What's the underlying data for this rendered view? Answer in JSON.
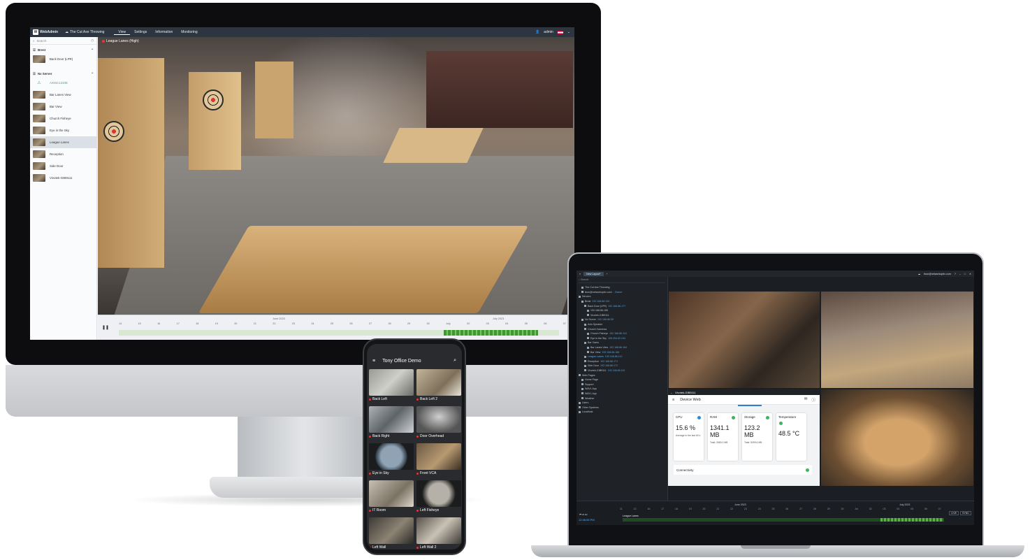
{
  "webadmin": {
    "brand": "WebAdmin",
    "site_name": "The Cut Axe Throwing",
    "nav": [
      "View",
      "Settings",
      "Information",
      "Monitoring"
    ],
    "user": "admin",
    "search_placeholder": "Search",
    "groups": [
      {
        "label": "Brest",
        "items": [
          "Back Door (LPR)"
        ]
      },
      {
        "label": "Nx Server",
        "items": [
          "AXISC1310E",
          "Bar Lanes View",
          "Bar View",
          "Church Fisheye",
          "Eye in the Sky",
          "League Lanes",
          "Reception",
          "Side Door",
          "Vivotek-GIB9111"
        ]
      }
    ],
    "active_item": "League Lanes",
    "video_label": "League Lanes (High)",
    "timeline": {
      "month_left": "June 2023",
      "month_right": "July 2023",
      "ticks": [
        "14",
        "15",
        "16",
        "17",
        "18",
        "19",
        "20",
        "21",
        "22",
        "23",
        "24",
        "25",
        "26",
        "27",
        "28",
        "29",
        "30",
        "July",
        "02",
        "03",
        "04",
        "05",
        "06",
        "07"
      ]
    }
  },
  "desktop": {
    "tab": "New Layout*",
    "account": "tbon@networkoptix.com",
    "search_placeholder": "Search",
    "tree": [
      {
        "label": "The Cut Axe Throwing",
        "ip": ""
      },
      {
        "label": "tbon@networkoptix.com",
        "ip": "- Owner"
      },
      {
        "label": "Servers",
        "ip": ""
      },
      {
        "label": "Brest",
        "ip": "192.168.86.130"
      },
      {
        "label": "Back Door (LPR)",
        "ip": "192.168.86.177"
      },
      {
        "label": "192.168.86.185",
        "ip": ""
      },
      {
        "label": "Vivotek-GIB9111",
        "ip": ""
      },
      {
        "label": "Nx Server",
        "ip": "192.168.86.59"
      },
      {
        "label": "Axis Speaker",
        "ip": ""
      },
      {
        "label": "Church Cameras",
        "ip": ""
      },
      {
        "label": "Church Fisheye",
        "ip": "192.168.86.110"
      },
      {
        "label": "Eye in the Sky",
        "ip": "169.254.62.244"
      },
      {
        "label": "Bar Cams",
        "ip": ""
      },
      {
        "label": "Bar Lanes View",
        "ip": "192.168.86.184"
      },
      {
        "label": "Bar View",
        "ip": "192.168.86.186"
      },
      {
        "label": "League Lanes",
        "ip": "192.168.86.112"
      },
      {
        "label": "Reception",
        "ip": "192.168.86.171"
      },
      {
        "label": "Side Door",
        "ip": "192.168.86.172"
      },
      {
        "label": "Vivotek-GIB9111",
        "ip": "192.168.86.119"
      },
      {
        "label": "Web Pages",
        "ip": ""
      },
      {
        "label": "Home Page",
        "ip": ""
      },
      {
        "label": "Support",
        "ip": ""
      },
      {
        "label": "WAVL App",
        "ip": ""
      },
      {
        "label": "WAYL App",
        "ip": ""
      },
      {
        "label": "Weather",
        "ip": ""
      },
      {
        "label": "Users",
        "ip": ""
      },
      {
        "label": "Other Systems",
        "ip": ""
      },
      {
        "label": "Localhost",
        "ip": ""
      }
    ],
    "device_web": {
      "camera": "Vivotek-GIB9111",
      "title": "Device Web",
      "cards": [
        {
          "label": "CPU",
          "value": "15.6 %",
          "sub": "Average in the last 60 s"
        },
        {
          "label": "RAM",
          "value": "1341.1 MB",
          "sub": "Total: 2680.0 MB"
        },
        {
          "label": "Storage",
          "value": "123.2 MB",
          "sub": "Total: 5099.6 MB"
        },
        {
          "label": "Temperature",
          "value": "48.5 °C",
          "sub": ""
        }
      ],
      "connectivity": "Connectivity"
    },
    "timeline": {
      "month_left": "June 2023",
      "month_right": "July 2023",
      "ticks": [
        "11",
        "13",
        "16",
        "17",
        "18",
        "19",
        "20",
        "21",
        "22",
        "23",
        "24",
        "25",
        "26",
        "27",
        "28",
        "29",
        "30",
        "Jul",
        "02",
        "03",
        "04",
        "05",
        "06",
        "07"
      ],
      "time": "12:36:55 PM",
      "camera": "League Lanes",
      "live": "LIVE",
      "sync": "SYNC"
    }
  },
  "mobile": {
    "title": "Tony Office Demo",
    "cameras": [
      "Back Left",
      "Back Left 2",
      "Back Right",
      "Door Overhead",
      "Eye in Sky",
      "Front VCA",
      "IT Room",
      "Left Fisheye",
      "Left Wall",
      "Left Wall 2"
    ]
  }
}
